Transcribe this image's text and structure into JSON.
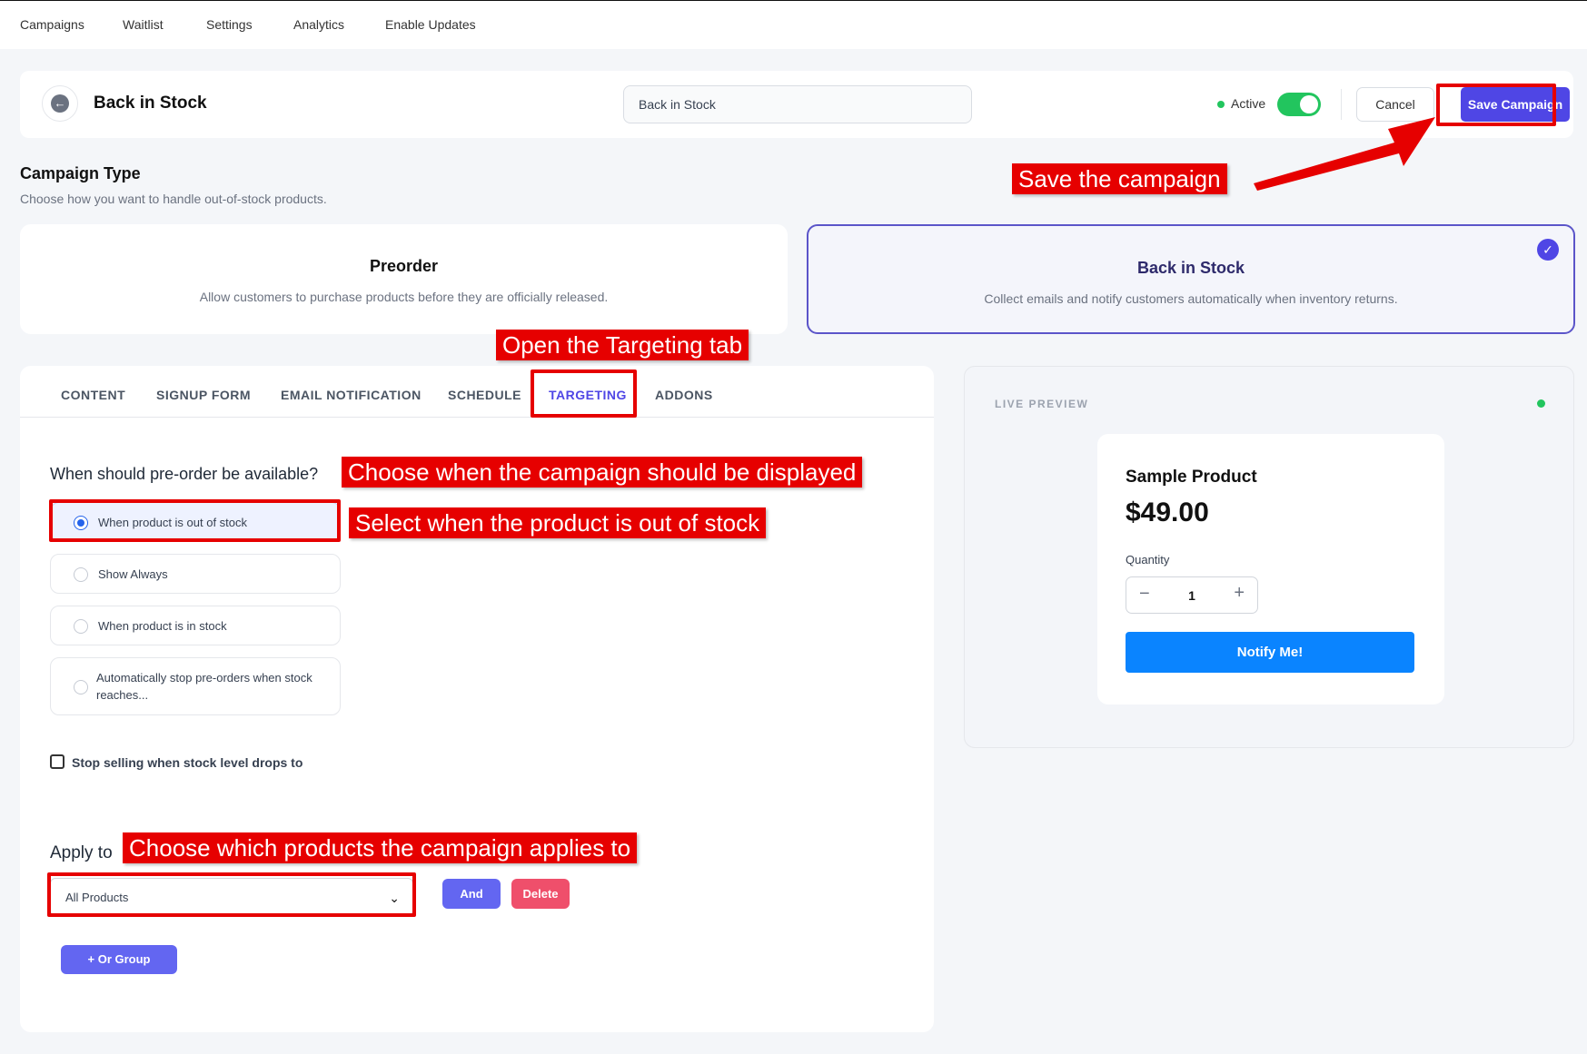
{
  "nav": {
    "items": [
      "Campaigns",
      "Waitlist",
      "Settings",
      "Analytics",
      "Enable Updates"
    ]
  },
  "header": {
    "title": "Back in Stock",
    "name_value": "Back in Stock",
    "active_label": "Active",
    "active_on": true,
    "cancel_label": "Cancel",
    "save_label": "Save Campaign"
  },
  "campaign_type": {
    "title": "Campaign Type",
    "subtitle": "Choose how you want to handle out-of-stock products.",
    "options": [
      {
        "title": "Preorder",
        "desc": "Allow customers to purchase products before they are officially released.",
        "selected": false
      },
      {
        "title": "Back in Stock",
        "desc": "Collect emails and notify customers automatically when inventory returns.",
        "selected": true
      }
    ]
  },
  "tabs": [
    "CONTENT",
    "SIGNUP FORM",
    "EMAIL NOTIFICATION",
    "SCHEDULE",
    "TARGETING",
    "ADDONS"
  ],
  "active_tab": "TARGETING",
  "targeting": {
    "question": "When should pre-order be available?",
    "options": [
      "When product is out of stock",
      "Show Always",
      "When product is in stock",
      "Automatically stop pre-orders when stock reaches..."
    ],
    "selected_option": "When product is out of stock",
    "stop_selling_label": "Stop selling when stock level drops to",
    "stop_selling_checked": false,
    "apply_to_label": "Apply to",
    "apply_to_value": "All Products",
    "and_label": "And",
    "delete_label": "Delete",
    "or_group_label": "+ Or Group"
  },
  "preview": {
    "label": "LIVE PREVIEW",
    "product_name": "Sample Product",
    "price": "$49.00",
    "quantity_label": "Quantity",
    "quantity": "1",
    "minus": "−",
    "plus": "+",
    "notify_label": "Notify Me!"
  },
  "annotations": {
    "save": "Save the campaign",
    "targeting_tab": "Open the Targeting tab",
    "when_display": "Choose when the campaign should be displayed",
    "out_of_stock": "Select when the product is out of stock",
    "apply_to": "Choose which products the campaign applies to"
  },
  "colors": {
    "accent": "#4f46e5",
    "annotation_red": "#e60000",
    "active_green": "#22c55e",
    "notify_blue": "#0a84ff",
    "delete_red": "#ef4f6b"
  }
}
